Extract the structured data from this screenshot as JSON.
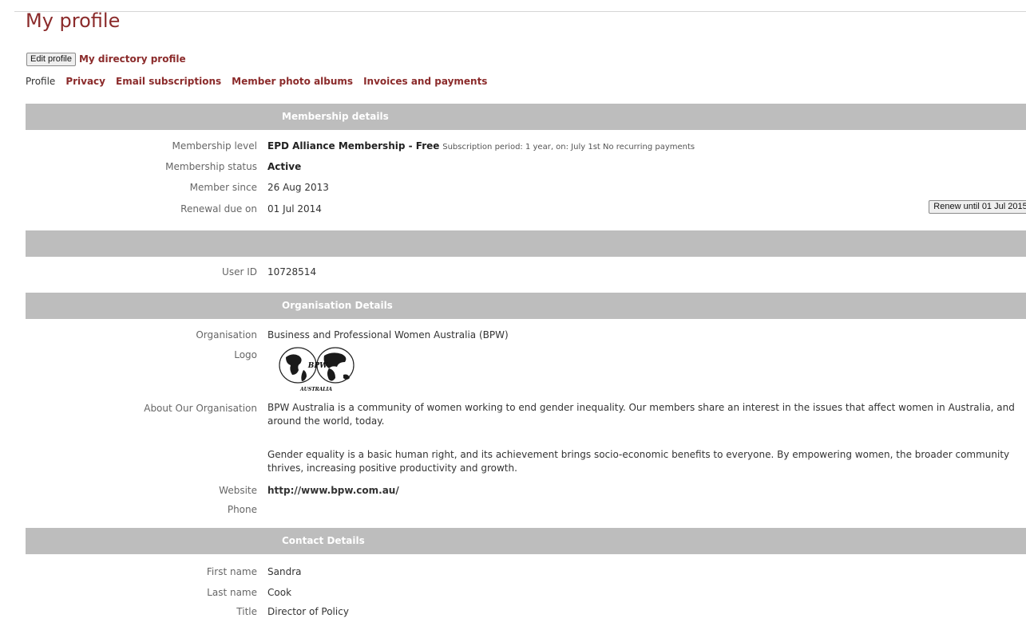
{
  "page": {
    "title": "My profile"
  },
  "actions": {
    "edit_profile": "Edit profile",
    "directory_profile": "My directory profile"
  },
  "subnav": {
    "profile": "Profile",
    "privacy": "Privacy",
    "email_subscriptions": "Email subscriptions",
    "photo_albums": "Member photo albums",
    "invoices": "Invoices and payments"
  },
  "membership": {
    "header": "Membership details",
    "level_label": "Membership level",
    "level_value": "EPD Alliance Membership - Free",
    "level_note": "Subscription period: 1 year, on: July 1st No recurring payments",
    "status_label": "Membership status",
    "status_value": "Active",
    "since_label": "Member since",
    "since_value": "26 Aug 2013",
    "renewal_label": "Renewal due on",
    "renewal_value": "01 Jul 2014",
    "renew_button": "Renew until 01 Jul 2015"
  },
  "user": {
    "id_label": "User ID",
    "id_value": "10728514"
  },
  "organisation": {
    "header": "Organisation Details",
    "org_label": "Organisation",
    "org_value": "Business and Professional Women Australia (BPW)",
    "logo_label": "Logo",
    "logo_text": "BPW",
    "logo_caption": "AUSTRALIA",
    "about_label": "About Our Organisation",
    "about_p1": "BPW Australia is a community of women working to end gender inequality. Our members share an interest in the issues that affect women in Australia, and around the world, today.",
    "about_p2": "Gender equality is a basic human right, and its achievement brings socio-economic benefits to everyone. By empowering women, the broader community thrives, increasing positive productivity and growth.",
    "website_label": "Website",
    "website_value": "http://www.bpw.com.au/",
    "phone_label": "Phone"
  },
  "contact": {
    "header": "Contact Details",
    "first_label": "First name",
    "first_value": "Sandra",
    "last_label": "Last name",
    "last_value": "Cook",
    "title_label": "Title",
    "title_value": "Director of Policy"
  },
  "colors": {
    "accent": "#8b2b2b",
    "section_bg": "#bdbdbd"
  }
}
